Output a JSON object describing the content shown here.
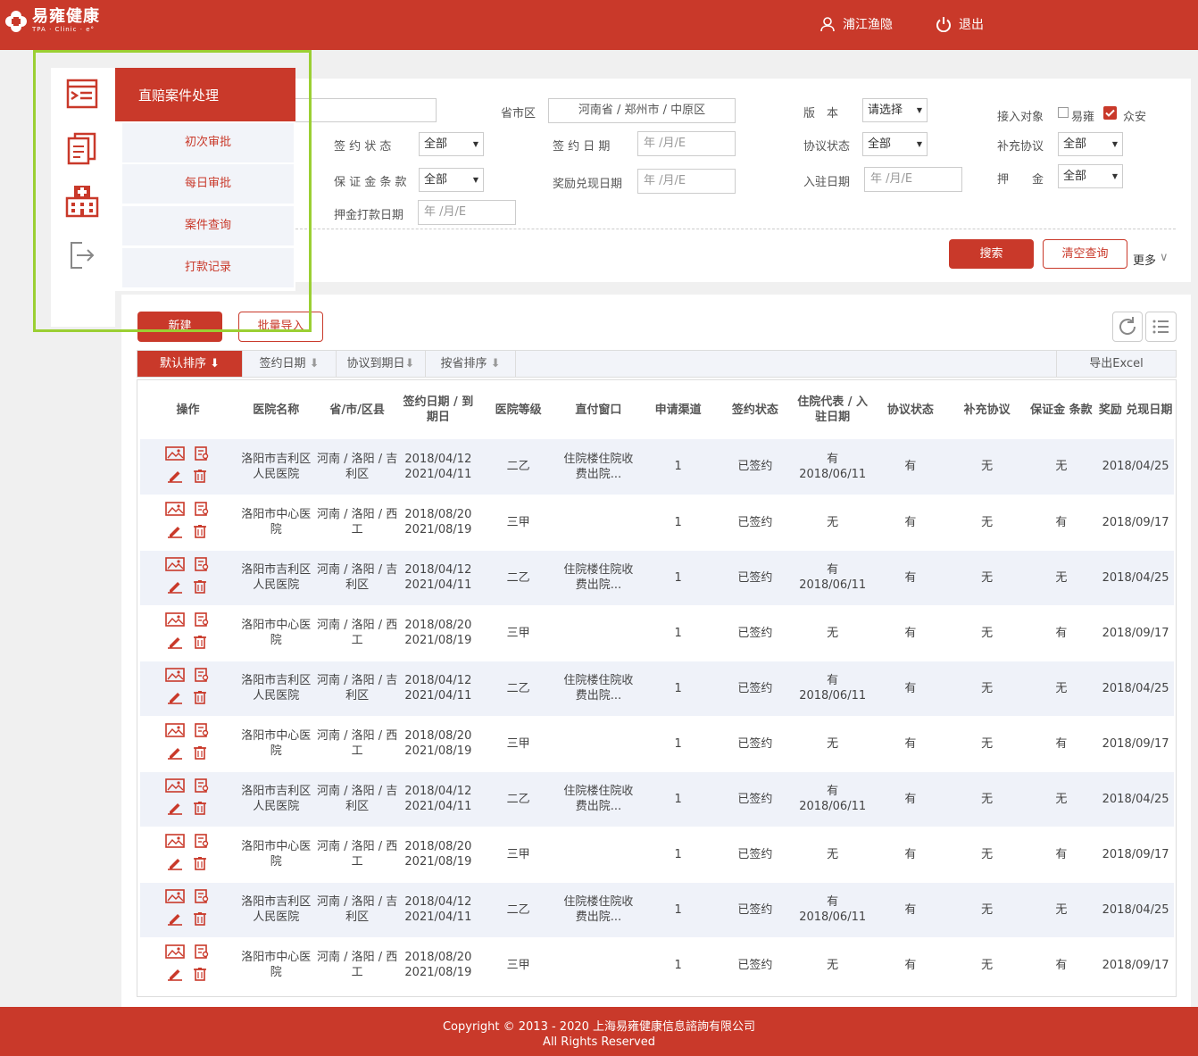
{
  "brand": {
    "name": "易雍健康",
    "sub": "TPA · Clinic · e°"
  },
  "header": {
    "user": "浦江渔隐",
    "logout": "退出"
  },
  "sidebar": {
    "icons": [
      "claim-process-icon",
      "documents-icon",
      "hospital-icon",
      "exit-icon"
    ]
  },
  "submenu": {
    "title": "直赔案件处理",
    "items": [
      "初次审批",
      "每日审批",
      "案件查询",
      "打款记录"
    ]
  },
  "filters": {
    "province_label": "省市区",
    "province_value": "河南省 / 郑州市 / 中原区",
    "version_label": "版　本",
    "version_value": "请选择",
    "access_label": "接入对象",
    "access_opt1": "易雍",
    "access_opt2": "众安",
    "sign_status_label": "签 约 状 态",
    "sign_status_value": "全部",
    "sign_date_label": "签 约 日 期",
    "date_placeholder": "年 /月/E",
    "agreement_status_label": "协议状态",
    "agreement_status_value": "全部",
    "supplement_label": "补充协议",
    "supplement_value": "全部",
    "deposit_clause_label": "保 证 金 条 款",
    "deposit_clause_value": "全部",
    "reward_date_label": "奖励兑现日期",
    "entry_date_label": "入驻日期",
    "deposit_label": "押　　金",
    "deposit_value": "全部",
    "deposit_pay_label": "押金打款日期"
  },
  "actions": {
    "search": "搜索",
    "clear": "清空查询",
    "more": "更多",
    "new": "新建",
    "batch": "批量导入",
    "export": "导出Excel"
  },
  "sort": [
    "默认排序",
    "签约日期",
    "协议到期日",
    "按省排序"
  ],
  "table": {
    "headers": [
      "操作",
      "医院名称",
      "省/市/区县",
      "签约日期 / 到期日",
      "医院等级",
      "直付窗口",
      "申请渠道",
      "签约状态",
      "住院代表 / 入驻日期",
      "协议状态",
      "补充协议",
      "保证金 条款",
      "奖励 兑现日期"
    ],
    "rows": [
      [
        "洛阳市吉利区人民医院",
        "河南 / 洛阳 / 吉利区",
        "2018/04/12 2021/04/11",
        "二乙",
        "住院楼住院收费出院...",
        "1",
        "已签约",
        "有 2018/06/11",
        "有",
        "无",
        "无",
        "2018/04/25"
      ],
      [
        "洛阳市中心医院",
        "河南 / 洛阳 / 西工",
        "2018/08/20 2021/08/19",
        "三甲",
        "",
        "1",
        "已签约",
        "无",
        "有",
        "无",
        "有",
        "2018/09/17"
      ],
      [
        "洛阳市吉利区人民医院",
        "河南 / 洛阳 / 吉利区",
        "2018/04/12 2021/04/11",
        "二乙",
        "住院楼住院收费出院...",
        "1",
        "已签约",
        "有 2018/06/11",
        "有",
        "无",
        "无",
        "2018/04/25"
      ],
      [
        "洛阳市中心医院",
        "河南 / 洛阳 / 西工",
        "2018/08/20 2021/08/19",
        "三甲",
        "",
        "1",
        "已签约",
        "无",
        "有",
        "无",
        "有",
        "2018/09/17"
      ],
      [
        "洛阳市吉利区人民医院",
        "河南 / 洛阳 / 吉利区",
        "2018/04/12 2021/04/11",
        "二乙",
        "住院楼住院收费出院...",
        "1",
        "已签约",
        "有 2018/06/11",
        "有",
        "无",
        "无",
        "2018/04/25"
      ],
      [
        "洛阳市中心医院",
        "河南 / 洛阳 / 西工",
        "2018/08/20 2021/08/19",
        "三甲",
        "",
        "1",
        "已签约",
        "无",
        "有",
        "无",
        "有",
        "2018/09/17"
      ],
      [
        "洛阳市吉利区人民医院",
        "河南 / 洛阳 / 吉利区",
        "2018/04/12 2021/04/11",
        "二乙",
        "住院楼住院收费出院...",
        "1",
        "已签约",
        "有 2018/06/11",
        "有",
        "无",
        "无",
        "2018/04/25"
      ],
      [
        "洛阳市中心医院",
        "河南 / 洛阳 / 西工",
        "2018/08/20 2021/08/19",
        "三甲",
        "",
        "1",
        "已签约",
        "无",
        "有",
        "无",
        "有",
        "2018/09/17"
      ],
      [
        "洛阳市吉利区人民医院",
        "河南 / 洛阳 / 吉利区",
        "2018/04/12 2021/04/11",
        "二乙",
        "住院楼住院收费出院...",
        "1",
        "已签约",
        "有 2018/06/11",
        "有",
        "无",
        "无",
        "2018/04/25"
      ],
      [
        "洛阳市中心医院",
        "河南 / 洛阳 / 西工",
        "2018/08/20 2021/08/19",
        "三甲",
        "",
        "1",
        "已签约",
        "无",
        "有",
        "无",
        "有",
        "2018/09/17"
      ]
    ]
  },
  "footer": {
    "line1": "Copyright © 2013 - 2020 上海易雍健康信息諮詢有限公司",
    "line2": "All Rights Reserved"
  },
  "colors": {
    "brand": "#c9392a",
    "highlight": "#9bcf33",
    "row_alt": "#eff2f9"
  }
}
